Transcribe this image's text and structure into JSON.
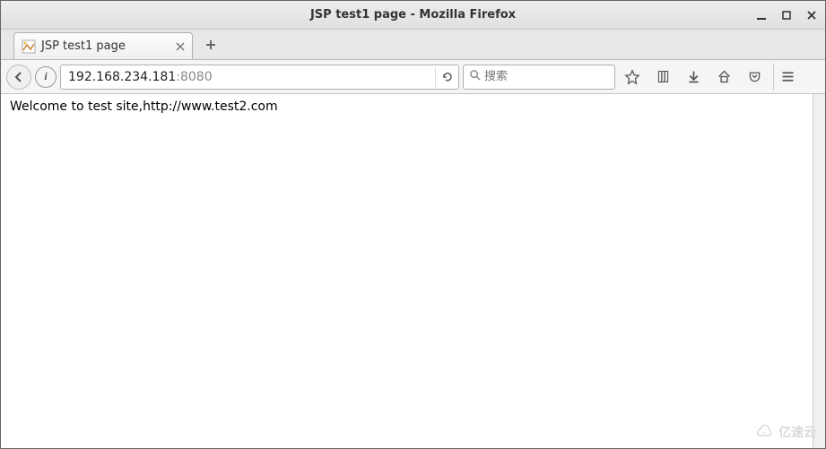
{
  "window": {
    "title": "JSP test1 page - Mozilla Firefox"
  },
  "tabs": [
    {
      "label": "JSP test1 page"
    }
  ],
  "url": {
    "host": "192.168.234.181",
    "port": ":8080"
  },
  "search": {
    "placeholder": "搜索"
  },
  "page": {
    "body_text": "Welcome to test site,http://www.test2.com"
  },
  "watermark": {
    "text": "亿速云"
  }
}
